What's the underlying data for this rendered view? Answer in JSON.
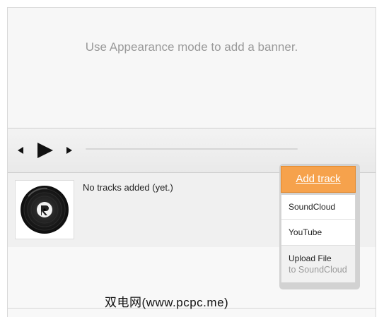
{
  "banner": {
    "text": "Use Appearance mode to add a banner."
  },
  "player": {
    "prev_icon": "previous-icon",
    "play_icon": "play-icon",
    "next_icon": "next-icon",
    "progress_percent": 0
  },
  "tracks": {
    "empty_text": "No tracks added (yet.)",
    "cover_icon": "vinyl-record-icon"
  },
  "add_track": {
    "label": "Add track",
    "color": "#f6a24c",
    "menu": [
      {
        "label": "SoundCloud"
      },
      {
        "label": "YouTube"
      },
      {
        "label": "Upload File",
        "sub": "to SoundCloud"
      }
    ]
  },
  "watermark": {
    "text": "双电网(www.pcpc.me)"
  }
}
